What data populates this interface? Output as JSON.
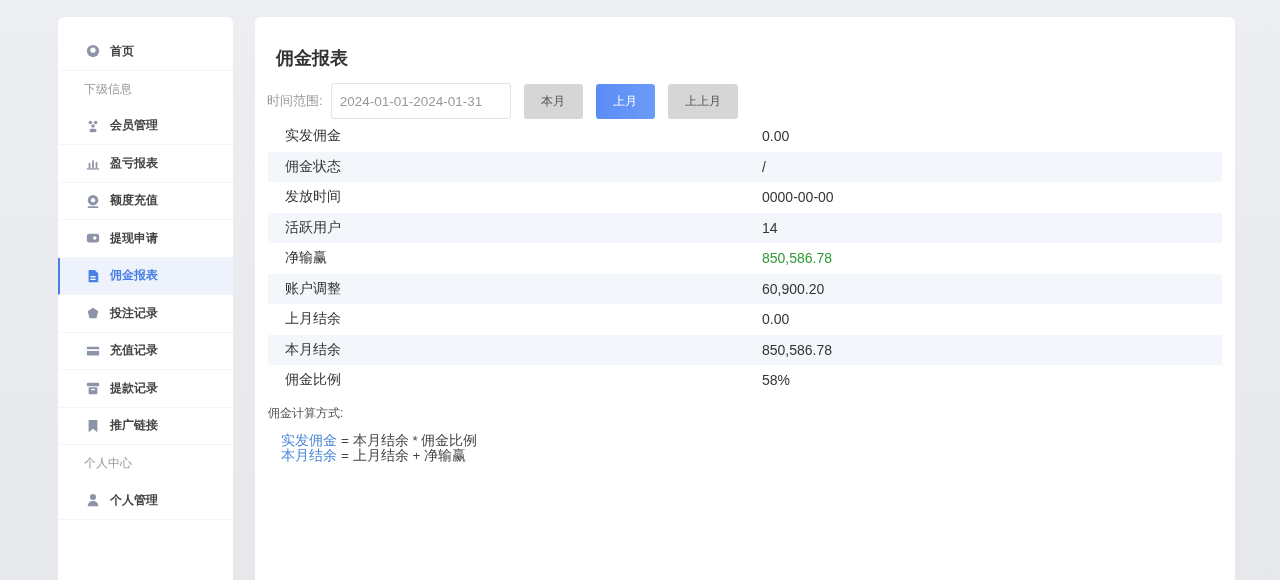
{
  "sidebar": [
    {
      "kind": "item",
      "label": "首页",
      "selected": false
    },
    {
      "kind": "section",
      "label": "下级信息"
    },
    {
      "kind": "item",
      "label": "会员管理",
      "selected": false
    },
    {
      "kind": "item",
      "label": "盈亏报表",
      "selected": false
    },
    {
      "kind": "item",
      "label": "额度充值",
      "selected": false
    },
    {
      "kind": "item",
      "label": "提现申请",
      "selected": false
    },
    {
      "kind": "item",
      "label": "佣金报表",
      "selected": true
    },
    {
      "kind": "item",
      "label": "投注记录",
      "selected": false
    },
    {
      "kind": "item",
      "label": "充值记录",
      "selected": false
    },
    {
      "kind": "item",
      "label": "提款记录",
      "selected": false
    },
    {
      "kind": "item",
      "label": "推广链接",
      "selected": false
    },
    {
      "kind": "section",
      "label": "个人中心"
    },
    {
      "kind": "item",
      "label": "个人管理",
      "selected": false
    }
  ],
  "page_title": "佣金报表",
  "filter": {
    "label": "时间范围:",
    "value": "2024-01-01-2024-01-31",
    "buttons": [
      {
        "label": "本月",
        "selected": false
      },
      {
        "label": "上月",
        "selected": true
      },
      {
        "label": "上上月",
        "selected": false
      }
    ]
  },
  "rows": [
    {
      "label": "实发佣金",
      "value": "0.00",
      "highlight": false
    },
    {
      "label": "佣金状态",
      "value": "/",
      "highlight": false
    },
    {
      "label": "发放时间",
      "value": "0000-00-00",
      "highlight": false
    },
    {
      "label": "活跃用户",
      "value": "14",
      "highlight": false
    },
    {
      "label": "净输赢",
      "value": "850,586.78",
      "highlight": true
    },
    {
      "label": "账户调整",
      "value": "60,900.20",
      "highlight": false
    },
    {
      "label": "上月结余",
      "value": "0.00",
      "highlight": false
    },
    {
      "label": "本月结余",
      "value": "850,586.78",
      "highlight": false
    },
    {
      "label": "佣金比例",
      "value": "58%",
      "highlight": false
    }
  ],
  "formula_title": "佣金计算方式:",
  "formulas": [
    {
      "term": "实发佣金",
      "expression": "= 本月结余 * 佣金比例"
    },
    {
      "term": "本月结余",
      "expression": "= 上月结余 + 净输赢"
    }
  ]
}
